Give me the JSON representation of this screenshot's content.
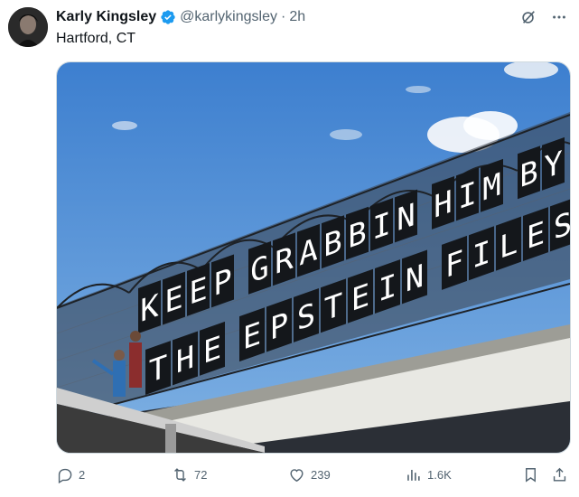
{
  "author": {
    "name": "Karly Kingsley",
    "handle": "@karlykingsley",
    "separator": "·",
    "time": "2h",
    "location": "Hartford, CT",
    "verified": true
  },
  "top_icons": [
    "grok-icon",
    "more-icon"
  ],
  "media": {
    "banner_line1": [
      "K",
      "E",
      "E",
      "P",
      "G",
      "R",
      "A",
      "B",
      "B",
      "I",
      "N",
      "H",
      "I",
      "M",
      "B",
      "Y"
    ],
    "banner_line2": [
      "T",
      "H",
      "E",
      "E",
      "P",
      "S",
      "T",
      "E",
      "I",
      "N",
      "F",
      "I",
      "L",
      "E",
      "S"
    ]
  },
  "actions": {
    "replies": "2",
    "reposts": "72",
    "likes": "239",
    "views": "1.6K"
  },
  "colors": {
    "accent": "#1d9bf0",
    "muted": "#536471",
    "text": "#0f1419"
  }
}
